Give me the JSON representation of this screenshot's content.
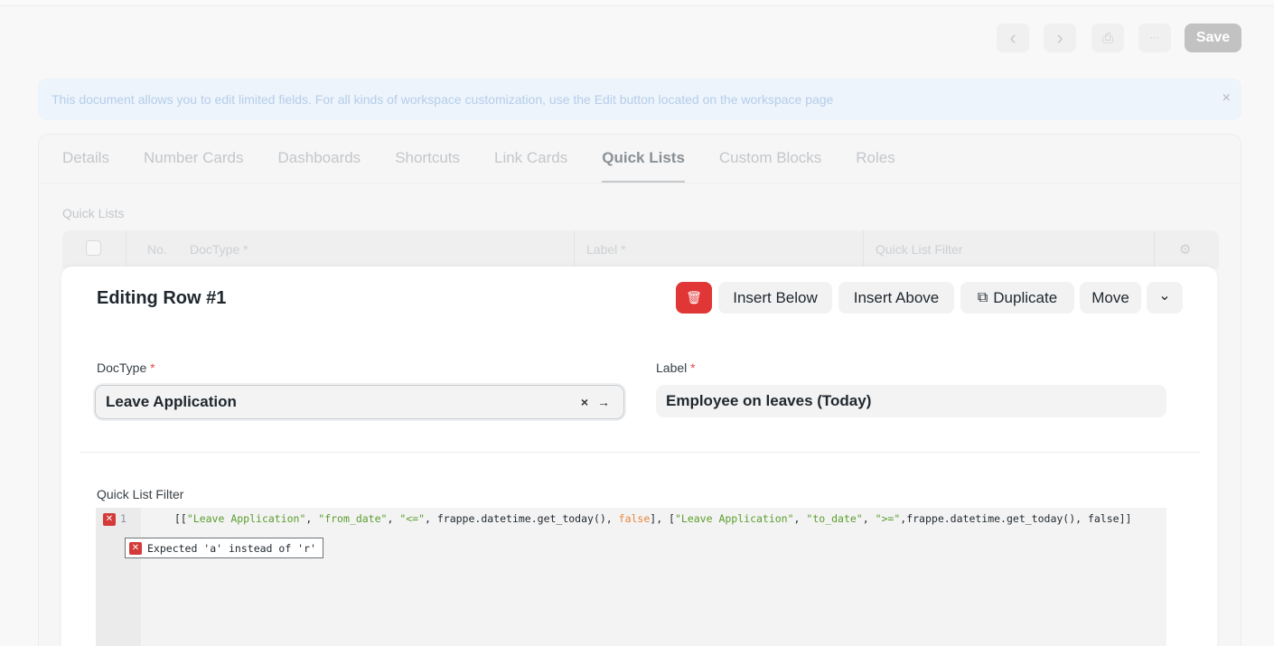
{
  "header": {
    "prev_icon": "‹",
    "next_icon": "›",
    "print_icon": "⎙",
    "more_icon": "···",
    "save_label": "Save"
  },
  "banner": {
    "message": "This document allows you to edit limited fields. For all kinds of workspace customization, use the Edit button located on the workspace page",
    "close_icon": "×"
  },
  "tabs": [
    {
      "label": "Details"
    },
    {
      "label": "Number Cards"
    },
    {
      "label": "Dashboards"
    },
    {
      "label": "Shortcuts"
    },
    {
      "label": "Link Cards"
    },
    {
      "label": "Quick Lists"
    },
    {
      "label": "Custom Blocks"
    },
    {
      "label": "Roles"
    }
  ],
  "active_tab": "Quick Lists",
  "section": {
    "label": "Quick Lists"
  },
  "grid": {
    "columns": {
      "no": "No.",
      "doctype": "DocType *",
      "label": "Label *",
      "filter": "Quick List Filter"
    }
  },
  "editor_panel": {
    "title": "Editing Row #1",
    "delete_icon": "🗑",
    "insert_below": "Insert Below",
    "insert_above": "Insert Above",
    "duplicate_icon": "⧉",
    "duplicate": "Duplicate",
    "move": "Move",
    "collapse_icon": "⌄"
  },
  "fields": {
    "doctype_label": "DocType",
    "doctype_value": "Leave Application",
    "doctype_icons": "× →",
    "label_label": "Label",
    "label_value": "Employee on leaves (Today)",
    "required_mark": "*"
  },
  "filter": {
    "label": "Quick List Filter",
    "line_number": "1",
    "error_icon": "✕",
    "code": {
      "p1": "[[",
      "s1": "\"Leave Application\"",
      "p2": ", ",
      "s2": "\"from_date\"",
      "p3": ", ",
      "s3": "\"<=\"",
      "p4": ", frappe.datetime.get_today(), ",
      "k1": "false",
      "p5": "], [",
      "s4": "\"Leave Application\"",
      "p6": ", ",
      "s5": "\"to_date\"",
      "p7": ", ",
      "s6": "\">=\"",
      "p8": ",frappe.datetime.get_today(), false]]"
    },
    "error_message": "Expected 'a' instead of 'r'"
  }
}
